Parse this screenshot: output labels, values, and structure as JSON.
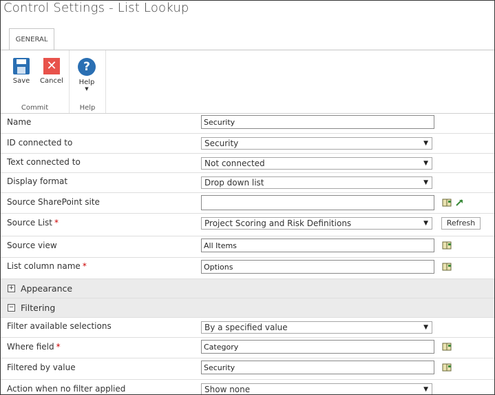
{
  "window": {
    "title": "Control Settings - List Lookup"
  },
  "ribbon": {
    "tab": "GENERAL",
    "groups": {
      "commit": {
        "label": "Commit",
        "save": "Save",
        "cancel": "Cancel"
      },
      "help": {
        "label": "Help",
        "help": "Help"
      }
    }
  },
  "fields": {
    "name": {
      "label": "Name",
      "value": "Security"
    },
    "id_connected": {
      "label": "ID connected to",
      "value": "Security"
    },
    "text_connected": {
      "label": "Text connected to",
      "value": "Not connected"
    },
    "display_format": {
      "label": "Display format",
      "value": "Drop down list"
    },
    "source_site": {
      "label": "Source SharePoint site",
      "value": ""
    },
    "source_list": {
      "label": "Source List",
      "required": "*",
      "value": "Project Scoring and Risk Definitions",
      "refresh": "Refresh"
    },
    "source_view": {
      "label": "Source view",
      "value": "All Items"
    },
    "list_column": {
      "label": "List column name",
      "required": "*",
      "value": "Options"
    }
  },
  "sections": {
    "appearance": {
      "title": "Appearance",
      "toggle": "+"
    },
    "filtering": {
      "title": "Filtering",
      "toggle": "−"
    }
  },
  "filtering": {
    "filter_selections": {
      "label": "Filter available selections",
      "value": "By a specified value"
    },
    "where_field": {
      "label": "Where field",
      "required": "*",
      "value": "Category"
    },
    "filtered_by": {
      "label": "Filtered by value",
      "value": "Security"
    },
    "action_no_filter": {
      "label": "Action when no filter applied",
      "value": "Show none"
    }
  },
  "icons": {
    "save": "floppy-disk",
    "cancel": "red-x",
    "help": "question-circle",
    "lookup": "address-book",
    "open": "open-link-arrow",
    "dropdown": "down-triangle"
  },
  "colors": {
    "save": "#2a6fb3",
    "cancel": "#e8524b",
    "help": "#2a6fb3",
    "required": "#cc0000",
    "section_bg": "#ebebeb"
  }
}
